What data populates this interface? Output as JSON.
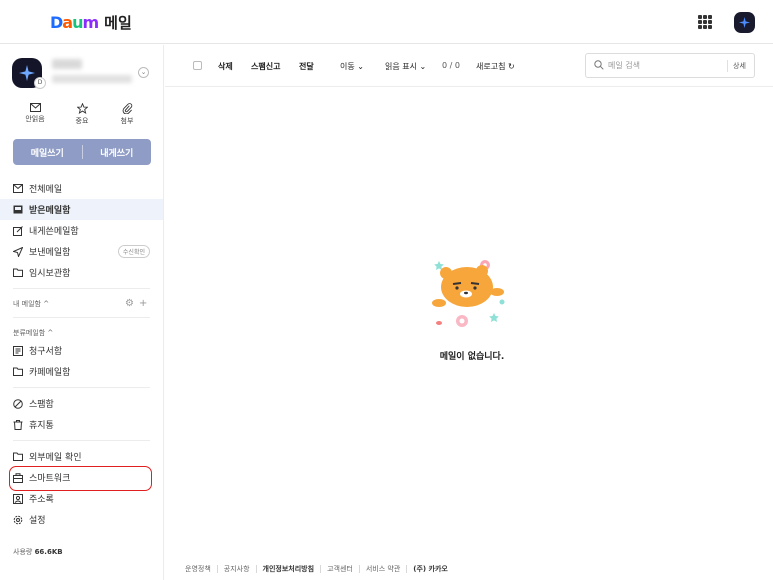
{
  "app": {
    "title": "메일"
  },
  "profile": {
    "badge": "D"
  },
  "quick": {
    "unread": "안읽음",
    "starred": "중요",
    "attach": "첨부"
  },
  "compose": {
    "write": "메일쓰기",
    "self": "내게쓰기"
  },
  "folders": [
    {
      "label": "전체메일"
    },
    {
      "label": "받은메일함"
    },
    {
      "label": "내게쓴메일함"
    },
    {
      "label": "보낸메일함",
      "extra": "수신확인"
    },
    {
      "label": "임시보관함"
    }
  ],
  "my_mailbox": {
    "label": "내 메일함 ^"
  },
  "category": {
    "label": "분류메일함 ^",
    "items": [
      {
        "label": "청구서함"
      },
      {
        "label": "카페메일함"
      }
    ]
  },
  "misc": [
    {
      "label": "스팸함"
    },
    {
      "label": "휴지통"
    }
  ],
  "extra": [
    {
      "label": "외부메일 확인"
    },
    {
      "label": "스마트워크"
    },
    {
      "label": "주소록"
    },
    {
      "label": "설정"
    }
  ],
  "storage": {
    "label": "사용량",
    "value": "66.6KB"
  },
  "toolbar": {
    "delete": "삭제",
    "spam": "스팸신고",
    "forward": "전달",
    "move": "이동 ⌄",
    "read": "읽음 표시 ⌄",
    "count": "0 / 0",
    "refresh": "새로고침 ↻"
  },
  "search": {
    "placeholder": "메일 검색",
    "detail": "상세"
  },
  "empty": {
    "text": "메일이 없습니다."
  },
  "footer": [
    "운영정책",
    "공지사항",
    "개인정보처리방침",
    "고객센터",
    "서비스 약관",
    "(주) 카카오"
  ]
}
